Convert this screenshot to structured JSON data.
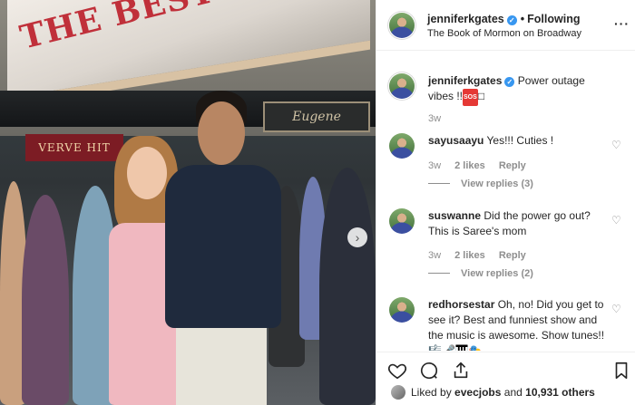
{
  "post": {
    "username": "jenniferkgates",
    "following_label": "Following",
    "location": "The Book of Mormon on Broadway",
    "more_label": "···"
  },
  "photo": {
    "marquee_text": "THE BEST MUSICAL",
    "sign_left": "VERVE   HIT",
    "sign_right": "Eugene",
    "next_arrow": "›"
  },
  "caption": {
    "username": "jenniferkgates",
    "text": "Power outage vibes !!",
    "emoji_label": "SOS",
    "emoji_tail": "□",
    "time": "3w"
  },
  "comments": [
    {
      "username": "sayusaayu",
      "text": "Yes!!! Cuties !",
      "time": "3w",
      "likes": "2 likes",
      "reply_label": "Reply",
      "view_replies": "View replies (3)"
    },
    {
      "username": "suswanne",
      "text": "Did the power go out? This is Saree's mom",
      "time": "3w",
      "likes": "2 likes",
      "reply_label": "Reply",
      "view_replies": "View replies (2)"
    },
    {
      "username": "redhorsestar",
      "text": "Oh, no! Did you get to see it? Best and funniest show and the music is awesome. Show tunes!! 🎼🎤🎹🎭"
    }
  ],
  "likes_bar": {
    "liked_by_prefix": "Liked by",
    "liked_by_user": "evecjobs",
    "and_text": "and",
    "others_count": "10,931 others"
  },
  "icons": {
    "like": "heart-icon",
    "comment": "comment-icon",
    "share": "share-icon",
    "save": "bookmark-icon"
  }
}
